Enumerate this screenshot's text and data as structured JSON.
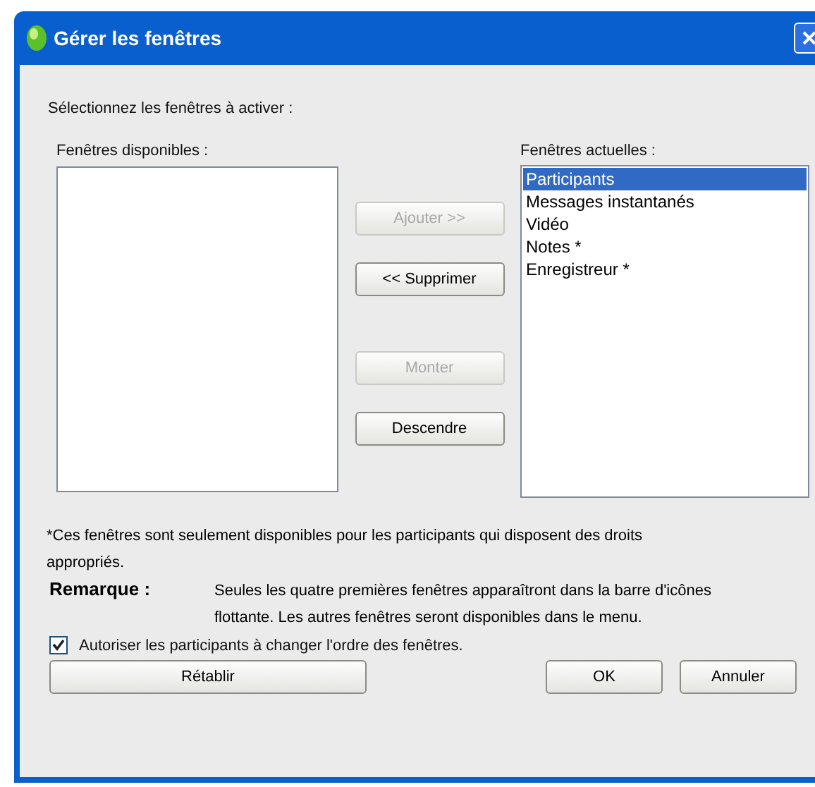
{
  "window": {
    "title": "Gérer les fenêtres"
  },
  "instruction": "Sélectionnez les fenêtres à activer :",
  "available": {
    "label": "Fenêtres disponibles :"
  },
  "current": {
    "label": "Fenêtres actuelles :",
    "items": [
      {
        "label": "Participants",
        "selected": true
      },
      {
        "label": "Messages instantanés",
        "selected": false
      },
      {
        "label": "Vidéo",
        "selected": false
      },
      {
        "label": "Notes *",
        "selected": false
      },
      {
        "label": "Enregistreur *",
        "selected": false
      }
    ]
  },
  "move_buttons": [
    {
      "label": "Ajouter >>",
      "disabled": true
    },
    {
      "label": "<< Supprimer",
      "disabled": false
    },
    {
      "label": "Monter",
      "disabled": true
    },
    {
      "label": "Descendre",
      "disabled": false
    }
  ],
  "footnote": "*Ces fenêtres sont seulement disponibles pour les participants qui disposent des droits appropriés.",
  "remark": {
    "label": "Remarque :",
    "text": "Seules les quatre premières fenêtres apparaîtront dans la barre d'icônes flottante. Les autres fenêtres seront disponibles dans le menu."
  },
  "allow_reorder": {
    "label": "Autoriser les participants à changer l'ordre des fenêtres.",
    "checked": true
  },
  "buttons": {
    "reset": "Rétablir",
    "ok": "OK",
    "cancel": "Annuler"
  }
}
